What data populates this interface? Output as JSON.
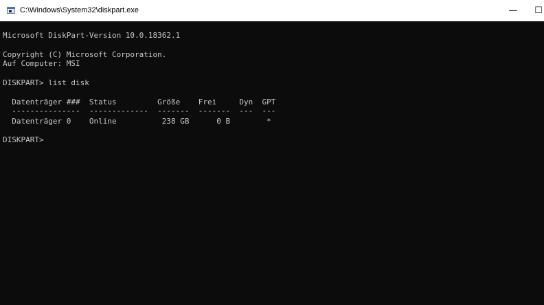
{
  "window": {
    "title": "C:\\Windows\\System32\\diskpart.exe",
    "minimize_glyph": "—",
    "maximize_glyph": "☐",
    "app_icon": "console-window-icon"
  },
  "console": {
    "lines": [
      "Microsoft DiskPart-Version 10.0.18362.1",
      "",
      "Copyright (C) Microsoft Corporation.",
      "Auf Computer: MSI",
      "",
      "DISKPART> list disk",
      "",
      "  Datenträger ###  Status         Größe    Frei     Dyn  GPT",
      "  ---------------  -------------  -------  -------  ---  ---",
      "  Datenträger 0    Online          238 GB      0 B        *",
      "",
      "DISKPART> "
    ]
  },
  "colors": {
    "console_background": "#0c0c0c",
    "console_text": "#c8c8c8",
    "titlebar_background": "#ffffff"
  }
}
